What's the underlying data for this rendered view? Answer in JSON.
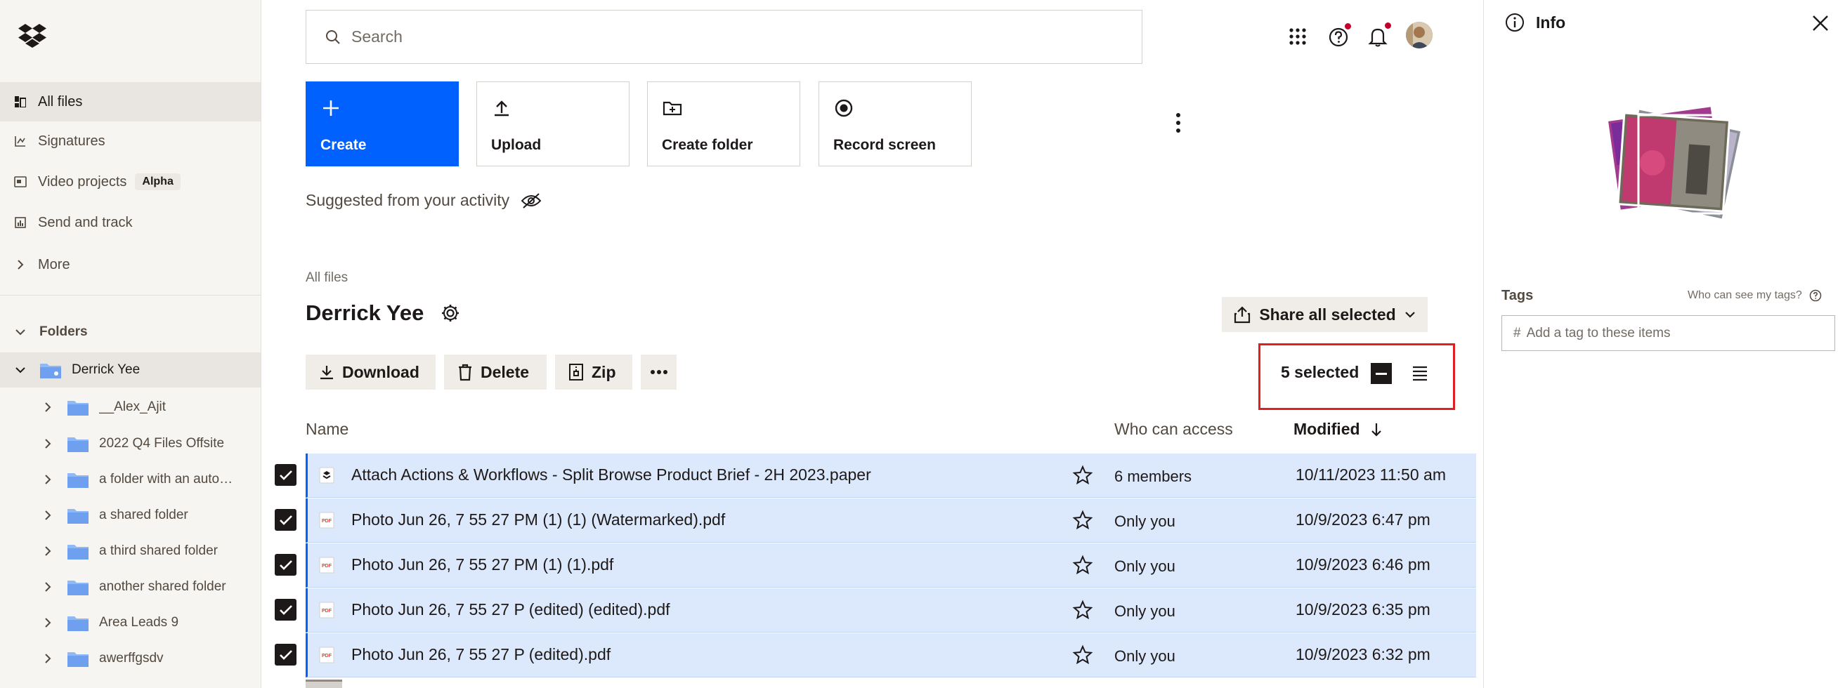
{
  "sidebar": {
    "nav": [
      {
        "label": "All files",
        "icon": "files-icon"
      },
      {
        "label": "Signatures",
        "icon": "signature-icon"
      },
      {
        "label": "Video projects",
        "icon": "video-icon",
        "badge": "Alpha"
      },
      {
        "label": "Send and track",
        "icon": "chart-icon"
      },
      {
        "label": "More",
        "icon": "chevron-right-icon"
      }
    ],
    "folders_heading": "Folders",
    "root_folder": "Derrick Yee",
    "folders": [
      "__Alex_Ajit",
      "2022 Q4 Files Offsite",
      "a folder with an auto…",
      "a shared folder",
      "a third shared folder",
      "another shared folder",
      "Area Leads 9",
      "awerffgsdv"
    ]
  },
  "search": {
    "placeholder": "Search"
  },
  "actions": [
    {
      "label": "Create",
      "icon": "plus-icon"
    },
    {
      "label": "Upload",
      "icon": "upload-icon"
    },
    {
      "label": "Create folder",
      "icon": "folder-plus-icon"
    },
    {
      "label": "Record screen",
      "icon": "record-icon"
    }
  ],
  "suggested": "Suggested from your activity",
  "breadcrumb": "All files",
  "page_title": "Derrick Yee",
  "share_all": "Share all selected",
  "toolbar": {
    "download": "Download",
    "delete": "Delete",
    "zip": "Zip"
  },
  "selection": {
    "text": "5 selected"
  },
  "columns": {
    "name": "Name",
    "access": "Who can access",
    "modified": "Modified"
  },
  "files": [
    {
      "name": "Attach Actions & Workflows - Split Browse Product Brief - 2H 2023.paper",
      "type": "paper",
      "access": "6 members",
      "modified": "10/11/2023 11:50 am"
    },
    {
      "name": "Photo Jun 26, 7 55 27 PM (1) (1) (Watermarked).pdf",
      "type": "pdf",
      "access": "Only you",
      "modified": "10/9/2023 6:47 pm"
    },
    {
      "name": "Photo Jun 26, 7 55 27 PM (1) (1).pdf",
      "type": "pdf",
      "access": "Only you",
      "modified": "10/9/2023 6:46 pm"
    },
    {
      "name": "Photo Jun 26, 7 55 27 P (edited) (edited).pdf",
      "type": "pdf",
      "access": "Only you",
      "modified": "10/9/2023 6:35 pm"
    },
    {
      "name": "Photo Jun 26, 7 55 27 P (edited).pdf",
      "type": "pdf",
      "access": "Only you",
      "modified": "10/9/2023 6:32 pm"
    }
  ],
  "pdf_label": "PDF",
  "info": {
    "title": "Info",
    "tags_label": "Tags",
    "tags_who": "Who can see my tags?",
    "tags_hash": "#",
    "tags_placeholder": "Add a tag to these items"
  },
  "colors": {
    "accent": "#0061fe",
    "selected_row": "#dce8fb",
    "highlight": "#e02020",
    "notification": "#c4002a"
  }
}
